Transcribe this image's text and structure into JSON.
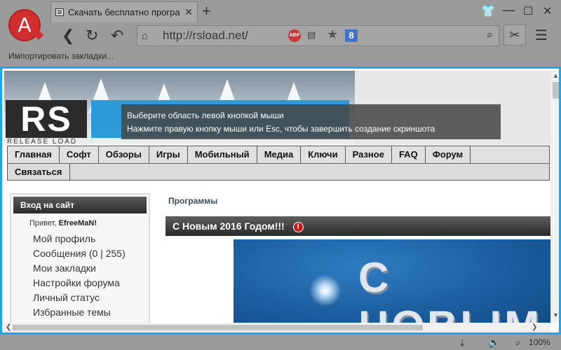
{
  "browser": {
    "logo_letter": "A",
    "tab_title": "Скачать бесплатно програм",
    "url": "http://rsload.net/",
    "abp_label": "ABP",
    "search_badge": "8",
    "bookmarks_text": "Импортировать закладки..."
  },
  "banner": {
    "brand_rs": "RS",
    "tagline": "RELEASE LOAD"
  },
  "tooltip": {
    "line1": "Выберите область левой кнопкой мыши",
    "line2": "Нажмите правую кнопку мыши или Esc, чтобы завершить создание скриншота"
  },
  "nav": {
    "row1": [
      "Главная",
      "Софт",
      "Обзоры",
      "Игры",
      "Мобильный",
      "Медиа",
      "Ключи",
      "Разное",
      "FAQ",
      "Форум"
    ],
    "row2": [
      "Связаться"
    ]
  },
  "login": {
    "title": "Вход на сайт",
    "greeting_prefix": "Привет,",
    "username": "EfreeMaN!",
    "links": [
      "Мой профиль",
      "Сообщения (0 | 255)",
      "Мои закладки",
      "Настройки форума",
      "Личный статус",
      "Избранные темы"
    ]
  },
  "content": {
    "breadcrumb": "Программы",
    "post_title": "С Новым 2016 Годом!!!",
    "warn_symbol": "!",
    "image_text": "С НОВЫМ"
  },
  "status": {
    "zoom": "100%"
  },
  "colors": {
    "selection_border": "#1aa6f0",
    "logo_red": "#cf2f2f",
    "brand_blue": "#2e9ad7"
  }
}
